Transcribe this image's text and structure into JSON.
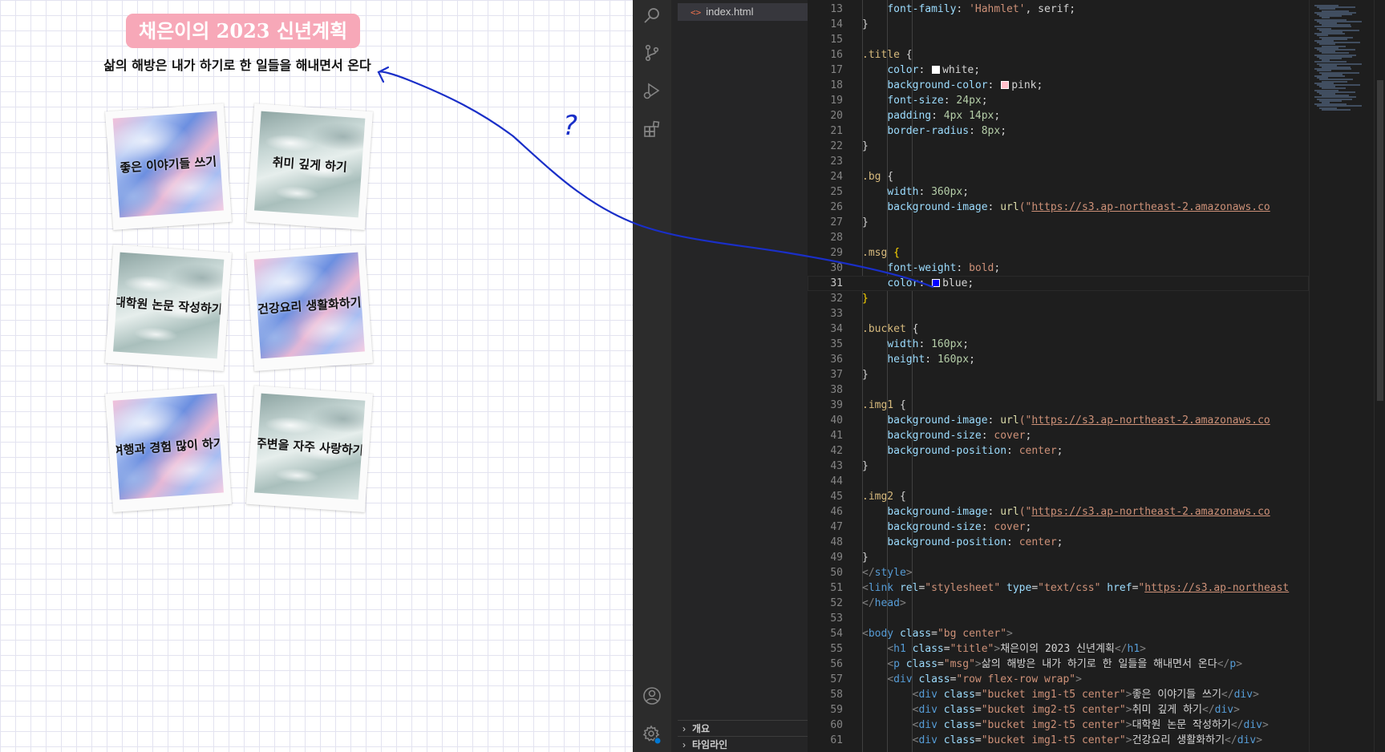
{
  "preview": {
    "title": "채은이의 2023 신년계획",
    "message": "삶의 해방은 내가 하기로 한 일들을 해내면서 온다",
    "cards": [
      {
        "label": "좋은 이야기들 쓰기",
        "style": "marble"
      },
      {
        "label": "취미 깊게 하기",
        "style": "water"
      },
      {
        "label": "대학원 논문 작성하기",
        "style": "water"
      },
      {
        "label": "건강요리 생활화하기",
        "style": "marble"
      },
      {
        "label": "여행과 경험 많이 하기",
        "style": "marble"
      },
      {
        "label": "주변을 자주 사랑하기",
        "style": "water"
      }
    ]
  },
  "annotation": {
    "question_mark": "?",
    "color": "#1a2fc8"
  },
  "editor": {
    "open_file": "index.html",
    "panels": [
      "개요",
      "타임라인"
    ],
    "active_line": 31,
    "colors": {
      "background": "#1e1e1e",
      "sidebar": "#252526",
      "activity_bar": "#2c2c2c"
    },
    "activity_icons": [
      "search-icon",
      "source-control-icon",
      "run-debug-icon",
      "extensions-icon",
      "account-icon",
      "settings-gear-icon"
    ],
    "lines": [
      {
        "n": 13,
        "tokens": [
          [
            "    ",
            ""
          ],
          [
            "font-family",
            "prop"
          ],
          [
            ": ",
            "txt"
          ],
          [
            "'Hahmlet'",
            "str"
          ],
          [
            ", serif;",
            "txt"
          ]
        ]
      },
      {
        "n": 14,
        "tokens": [
          [
            "}",
            "txt"
          ]
        ]
      },
      {
        "n": 15,
        "tokens": []
      },
      {
        "n": 16,
        "tokens": [
          [
            ".title",
            "sel"
          ],
          [
            " {",
            "txt"
          ]
        ]
      },
      {
        "n": 17,
        "tokens": [
          [
            "    ",
            ""
          ],
          [
            "color",
            "prop"
          ],
          [
            ": ",
            "txt"
          ],
          [
            "#ffffff",
            "swatch"
          ],
          [
            "white",
            "txt"
          ],
          [
            ";",
            "txt"
          ]
        ]
      },
      {
        "n": 18,
        "tokens": [
          [
            "    ",
            ""
          ],
          [
            "background-color",
            "prop"
          ],
          [
            ": ",
            "txt"
          ],
          [
            "#ffc0cb",
            "swatch"
          ],
          [
            "pink",
            "txt"
          ],
          [
            ";",
            "txt"
          ]
        ]
      },
      {
        "n": 19,
        "tokens": [
          [
            "    ",
            ""
          ],
          [
            "font-size",
            "prop"
          ],
          [
            ": ",
            "txt"
          ],
          [
            "24px",
            "num"
          ],
          [
            ";",
            "txt"
          ]
        ]
      },
      {
        "n": 20,
        "tokens": [
          [
            "    ",
            ""
          ],
          [
            "padding",
            "prop"
          ],
          [
            ": ",
            "txt"
          ],
          [
            "4px 14px",
            "num"
          ],
          [
            ";",
            "txt"
          ]
        ]
      },
      {
        "n": 21,
        "tokens": [
          [
            "    ",
            ""
          ],
          [
            "border-radius",
            "prop"
          ],
          [
            ": ",
            "txt"
          ],
          [
            "8px",
            "num"
          ],
          [
            ";",
            "txt"
          ]
        ]
      },
      {
        "n": 22,
        "tokens": [
          [
            "}",
            "txt"
          ]
        ]
      },
      {
        "n": 23,
        "tokens": []
      },
      {
        "n": 24,
        "tokens": [
          [
            ".bg",
            "sel"
          ],
          [
            " {",
            "txt"
          ]
        ]
      },
      {
        "n": 25,
        "tokens": [
          [
            "    ",
            ""
          ],
          [
            "width",
            "prop"
          ],
          [
            ": ",
            "txt"
          ],
          [
            "360px",
            "num"
          ],
          [
            ";",
            "txt"
          ]
        ]
      },
      {
        "n": 26,
        "tokens": [
          [
            "    ",
            ""
          ],
          [
            "background-image",
            "prop"
          ],
          [
            ": ",
            "txt"
          ],
          [
            "url",
            "fn"
          ],
          [
            "(\"",
            "str"
          ],
          [
            "https://s3.ap-northeast-2.amazonaws.co",
            "url"
          ]
        ]
      },
      {
        "n": 27,
        "tokens": [
          [
            "}",
            "txt"
          ]
        ]
      },
      {
        "n": 28,
        "tokens": []
      },
      {
        "n": 29,
        "tokens": [
          [
            ".msg",
            "sel"
          ],
          [
            " ",
            "txt"
          ],
          [
            "{",
            "brace"
          ]
        ]
      },
      {
        "n": 30,
        "tokens": [
          [
            "    ",
            ""
          ],
          [
            "font-weight",
            "prop"
          ],
          [
            ": ",
            "txt"
          ],
          [
            "bold",
            "str"
          ],
          [
            ";",
            "txt"
          ]
        ]
      },
      {
        "n": 31,
        "tokens": [
          [
            "    ",
            ""
          ],
          [
            "color",
            "prop"
          ],
          [
            ": ",
            "txt"
          ],
          [
            "#0000ff",
            "swatch"
          ],
          [
            "blue",
            "txt"
          ],
          [
            ";",
            "txt"
          ]
        ]
      },
      {
        "n": 32,
        "tokens": [
          [
            "}",
            "brace"
          ]
        ]
      },
      {
        "n": 33,
        "tokens": []
      },
      {
        "n": 34,
        "tokens": [
          [
            ".bucket",
            "sel"
          ],
          [
            " {",
            "txt"
          ]
        ]
      },
      {
        "n": 35,
        "tokens": [
          [
            "    ",
            ""
          ],
          [
            "width",
            "prop"
          ],
          [
            ": ",
            "txt"
          ],
          [
            "160px",
            "num"
          ],
          [
            ";",
            "txt"
          ]
        ]
      },
      {
        "n": 36,
        "tokens": [
          [
            "    ",
            ""
          ],
          [
            "height",
            "prop"
          ],
          [
            ": ",
            "txt"
          ],
          [
            "160px",
            "num"
          ],
          [
            ";",
            "txt"
          ]
        ]
      },
      {
        "n": 37,
        "tokens": [
          [
            "}",
            "txt"
          ]
        ]
      },
      {
        "n": 38,
        "tokens": []
      },
      {
        "n": 39,
        "tokens": [
          [
            ".img1",
            "sel"
          ],
          [
            " {",
            "txt"
          ]
        ]
      },
      {
        "n": 40,
        "tokens": [
          [
            "    ",
            ""
          ],
          [
            "background-image",
            "prop"
          ],
          [
            ": ",
            "txt"
          ],
          [
            "url",
            "fn"
          ],
          [
            "(\"",
            "str"
          ],
          [
            "https://s3.ap-northeast-2.amazonaws.co",
            "url"
          ]
        ]
      },
      {
        "n": 41,
        "tokens": [
          [
            "    ",
            ""
          ],
          [
            "background-size",
            "prop"
          ],
          [
            ": ",
            "txt"
          ],
          [
            "cover",
            "str"
          ],
          [
            ";",
            "txt"
          ]
        ]
      },
      {
        "n": 42,
        "tokens": [
          [
            "    ",
            ""
          ],
          [
            "background-position",
            "prop"
          ],
          [
            ": ",
            "txt"
          ],
          [
            "center",
            "str"
          ],
          [
            ";",
            "txt"
          ]
        ]
      },
      {
        "n": 43,
        "tokens": [
          [
            "}",
            "txt"
          ]
        ]
      },
      {
        "n": 44,
        "tokens": []
      },
      {
        "n": 45,
        "tokens": [
          [
            ".img2",
            "sel"
          ],
          [
            " {",
            "txt"
          ]
        ]
      },
      {
        "n": 46,
        "tokens": [
          [
            "    ",
            ""
          ],
          [
            "background-image",
            "prop"
          ],
          [
            ": ",
            "txt"
          ],
          [
            "url",
            "fn"
          ],
          [
            "(\"",
            "str"
          ],
          [
            "https://s3.ap-northeast-2.amazonaws.co",
            "url"
          ]
        ]
      },
      {
        "n": 47,
        "tokens": [
          [
            "    ",
            ""
          ],
          [
            "background-size",
            "prop"
          ],
          [
            ": ",
            "txt"
          ],
          [
            "cover",
            "str"
          ],
          [
            ";",
            "txt"
          ]
        ]
      },
      {
        "n": 48,
        "tokens": [
          [
            "    ",
            ""
          ],
          [
            "background-position",
            "prop"
          ],
          [
            ": ",
            "txt"
          ],
          [
            "center",
            "str"
          ],
          [
            ";",
            "txt"
          ]
        ]
      },
      {
        "n": 49,
        "tokens": [
          [
            "}",
            "txt"
          ]
        ]
      },
      {
        "n": 50,
        "tokens": [
          [
            "</",
            "punct"
          ],
          [
            "style",
            "tag"
          ],
          [
            ">",
            "punct"
          ]
        ]
      },
      {
        "n": 51,
        "tokens": [
          [
            "<",
            "punct"
          ],
          [
            "link",
            "tag"
          ],
          [
            " ",
            "txt"
          ],
          [
            "rel",
            "attr"
          ],
          [
            "=",
            "txt"
          ],
          [
            "\"stylesheet\"",
            "str"
          ],
          [
            " ",
            "txt"
          ],
          [
            "type",
            "attr"
          ],
          [
            "=",
            "txt"
          ],
          [
            "\"text/css\"",
            "str"
          ],
          [
            " ",
            "txt"
          ],
          [
            "href",
            "attr"
          ],
          [
            "=",
            "txt"
          ],
          [
            "\"",
            "str"
          ],
          [
            "https://s3.ap-northeast",
            "url"
          ]
        ]
      },
      {
        "n": 52,
        "tokens": [
          [
            "</",
            "punct"
          ],
          [
            "head",
            "tag"
          ],
          [
            ">",
            "punct"
          ]
        ]
      },
      {
        "n": 53,
        "tokens": []
      },
      {
        "n": 54,
        "tokens": [
          [
            "<",
            "punct"
          ],
          [
            "body",
            "tag"
          ],
          [
            " ",
            "txt"
          ],
          [
            "class",
            "attr"
          ],
          [
            "=",
            "txt"
          ],
          [
            "\"bg center\"",
            "str"
          ],
          [
            ">",
            "punct"
          ]
        ]
      },
      {
        "n": 55,
        "tokens": [
          [
            "    ",
            ""
          ],
          [
            "<",
            "punct"
          ],
          [
            "h1",
            "tag"
          ],
          [
            " ",
            "txt"
          ],
          [
            "class",
            "attr"
          ],
          [
            "=",
            "txt"
          ],
          [
            "\"title\"",
            "str"
          ],
          [
            ">",
            "punct"
          ],
          [
            "채은이의 2023 신년계획",
            "txt"
          ],
          [
            "</",
            "punct"
          ],
          [
            "h1",
            "tag"
          ],
          [
            ">",
            "punct"
          ]
        ]
      },
      {
        "n": 56,
        "tokens": [
          [
            "    ",
            ""
          ],
          [
            "<",
            "punct"
          ],
          [
            "p",
            "tag"
          ],
          [
            " ",
            "txt"
          ],
          [
            "class",
            "attr"
          ],
          [
            "=",
            "txt"
          ],
          [
            "\"msg\"",
            "str"
          ],
          [
            ">",
            "punct"
          ],
          [
            "삶의 해방은 내가 하기로 한 일들을 해내면서 온다",
            "txt"
          ],
          [
            "</",
            "punct"
          ],
          [
            "p",
            "tag"
          ],
          [
            ">",
            "punct"
          ]
        ]
      },
      {
        "n": 57,
        "tokens": [
          [
            "    ",
            ""
          ],
          [
            "<",
            "punct"
          ],
          [
            "div",
            "tag"
          ],
          [
            " ",
            "txt"
          ],
          [
            "class",
            "attr"
          ],
          [
            "=",
            "txt"
          ],
          [
            "\"row flex-row wrap\"",
            "str"
          ],
          [
            ">",
            "punct"
          ]
        ]
      },
      {
        "n": 58,
        "tokens": [
          [
            "        ",
            ""
          ],
          [
            "<",
            "punct"
          ],
          [
            "div",
            "tag"
          ],
          [
            " ",
            "txt"
          ],
          [
            "class",
            "attr"
          ],
          [
            "=",
            "txt"
          ],
          [
            "\"bucket img1-t5 center\"",
            "str"
          ],
          [
            ">",
            "punct"
          ],
          [
            "좋은 이야기들 쓰기",
            "txt"
          ],
          [
            "</",
            "punct"
          ],
          [
            "div",
            "tag"
          ],
          [
            ">",
            "punct"
          ]
        ]
      },
      {
        "n": 59,
        "tokens": [
          [
            "        ",
            ""
          ],
          [
            "<",
            "punct"
          ],
          [
            "div",
            "tag"
          ],
          [
            " ",
            "txt"
          ],
          [
            "class",
            "attr"
          ],
          [
            "=",
            "txt"
          ],
          [
            "\"bucket img2-t5 center\"",
            "str"
          ],
          [
            ">",
            "punct"
          ],
          [
            "취미 깊게 하기",
            "txt"
          ],
          [
            "</",
            "punct"
          ],
          [
            "div",
            "tag"
          ],
          [
            ">",
            "punct"
          ]
        ]
      },
      {
        "n": 60,
        "tokens": [
          [
            "        ",
            ""
          ],
          [
            "<",
            "punct"
          ],
          [
            "div",
            "tag"
          ],
          [
            " ",
            "txt"
          ],
          [
            "class",
            "attr"
          ],
          [
            "=",
            "txt"
          ],
          [
            "\"bucket img2-t5 center\"",
            "str"
          ],
          [
            ">",
            "punct"
          ],
          [
            "대학원 논문 작성하기",
            "txt"
          ],
          [
            "</",
            "punct"
          ],
          [
            "div",
            "tag"
          ],
          [
            ">",
            "punct"
          ]
        ]
      },
      {
        "n": 61,
        "tokens": [
          [
            "        ",
            ""
          ],
          [
            "<",
            "punct"
          ],
          [
            "div",
            "tag"
          ],
          [
            " ",
            "txt"
          ],
          [
            "class",
            "attr"
          ],
          [
            "=",
            "txt"
          ],
          [
            "\"bucket img1-t5 center\"",
            "str"
          ],
          [
            ">",
            "punct"
          ],
          [
            "건강요리 생활화하기",
            "txt"
          ],
          [
            "</",
            "punct"
          ],
          [
            "div",
            "tag"
          ],
          [
            ">",
            "punct"
          ]
        ]
      }
    ]
  }
}
